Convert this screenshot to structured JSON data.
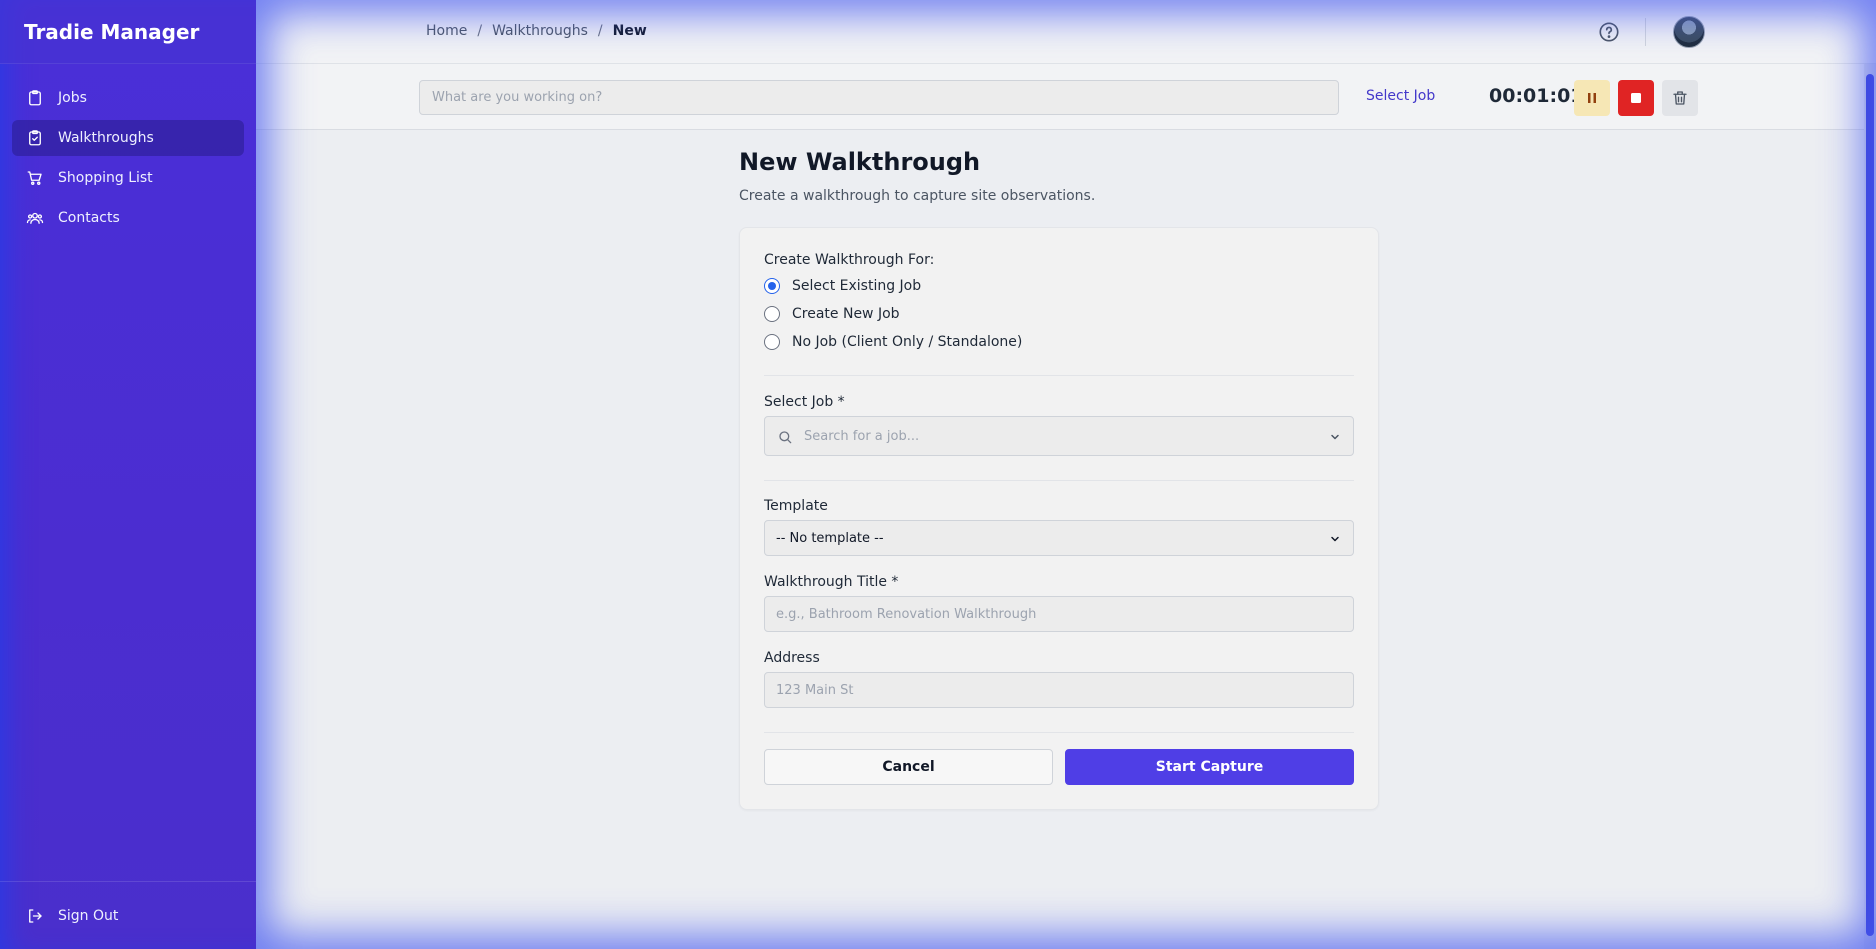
{
  "app": {
    "title": "Tradie Manager"
  },
  "sidebar": {
    "items": [
      {
        "label": "Jobs",
        "icon": "clipboard-icon",
        "active": false
      },
      {
        "label": "Walkthroughs",
        "icon": "clipboard-check-icon",
        "active": true
      },
      {
        "label": "Shopping List",
        "icon": "cart-icon",
        "active": false
      },
      {
        "label": "Contacts",
        "icon": "users-icon",
        "active": false
      }
    ],
    "sign_out": "Sign Out"
  },
  "breadcrumb": {
    "home": "Home",
    "section": "Walkthroughs",
    "current": "New",
    "separator": "/"
  },
  "timerbar": {
    "placeholder": "What are you working on?",
    "select_job": "Select Job",
    "time": "00:01:01"
  },
  "page": {
    "title": "New Walkthrough",
    "subtitle": "Create a walkthrough to capture site observations."
  },
  "form": {
    "create_for_label": "Create Walkthrough For:",
    "options": [
      {
        "label": "Select Existing Job",
        "checked": true
      },
      {
        "label": "Create New Job",
        "checked": false
      },
      {
        "label": "No Job (Client Only / Standalone)",
        "checked": false
      }
    ],
    "select_job_label": "Select Job *",
    "select_job_placeholder": "Search for a job...",
    "template_label": "Template",
    "template_value": "-- No template --",
    "title_label": "Walkthrough Title *",
    "title_placeholder": "e.g., Bathroom Renovation Walkthrough",
    "address_label": "Address",
    "address_placeholder": "123 Main St",
    "cancel": "Cancel",
    "submit": "Start Capture"
  },
  "colors": {
    "brand": "#4a2fd8",
    "primary": "#4f3ee6",
    "stop": "#e02424",
    "pause": "#f6e7b5"
  }
}
